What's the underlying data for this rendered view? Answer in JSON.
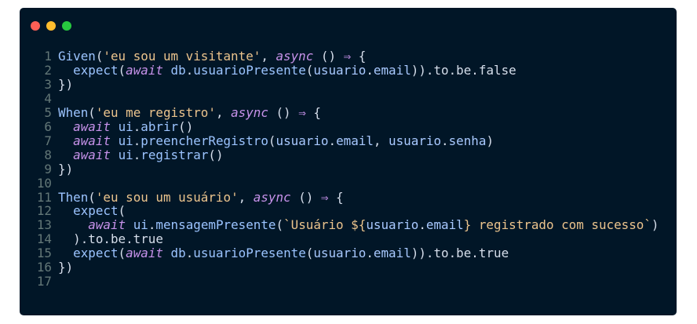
{
  "window": {
    "controls": [
      {
        "name": "close",
        "color": "#ff5f56"
      },
      {
        "name": "minimize",
        "color": "#ffbd2e"
      },
      {
        "name": "maximize",
        "color": "#27c93f"
      }
    ]
  },
  "code": {
    "lines": [
      [
        [
          "fn",
          "Given"
        ],
        [
          "p",
          "("
        ],
        [
          "str",
          "'eu sou um visitante'"
        ],
        [
          "p",
          ", "
        ],
        [
          "kw",
          "async"
        ],
        [
          "p",
          " () "
        ],
        [
          "op",
          "⇒"
        ],
        [
          "p",
          " {"
        ]
      ],
      [
        [
          "p",
          "  "
        ],
        [
          "fn",
          "expect"
        ],
        [
          "p",
          "("
        ],
        [
          "kw",
          "await"
        ],
        [
          "p",
          " "
        ],
        [
          "fn",
          "db"
        ],
        [
          "p",
          "."
        ],
        [
          "fn",
          "usuarioPresente"
        ],
        [
          "p",
          "("
        ],
        [
          "var",
          "usuario"
        ],
        [
          "p",
          "."
        ],
        [
          "var",
          "email"
        ],
        [
          "p",
          "))"
        ],
        [
          "p",
          ".to.be.false"
        ]
      ],
      [
        [
          "p",
          "})"
        ]
      ],
      [],
      [
        [
          "fn",
          "When"
        ],
        [
          "p",
          "("
        ],
        [
          "str",
          "'eu me registro'"
        ],
        [
          "p",
          ", "
        ],
        [
          "kw",
          "async"
        ],
        [
          "p",
          " () "
        ],
        [
          "op",
          "⇒"
        ],
        [
          "p",
          " {"
        ]
      ],
      [
        [
          "p",
          "  "
        ],
        [
          "kw",
          "await"
        ],
        [
          "p",
          " "
        ],
        [
          "fn",
          "ui"
        ],
        [
          "p",
          "."
        ],
        [
          "fn",
          "abrir"
        ],
        [
          "p",
          "()"
        ]
      ],
      [
        [
          "p",
          "  "
        ],
        [
          "kw",
          "await"
        ],
        [
          "p",
          " "
        ],
        [
          "fn",
          "ui"
        ],
        [
          "p",
          "."
        ],
        [
          "fn",
          "preencherRegistro"
        ],
        [
          "p",
          "("
        ],
        [
          "var",
          "usuario"
        ],
        [
          "p",
          "."
        ],
        [
          "var",
          "email"
        ],
        [
          "p",
          ", "
        ],
        [
          "var",
          "usuario"
        ],
        [
          "p",
          "."
        ],
        [
          "var",
          "senha"
        ],
        [
          "p",
          ")"
        ]
      ],
      [
        [
          "p",
          "  "
        ],
        [
          "kw",
          "await"
        ],
        [
          "p",
          " "
        ],
        [
          "fn",
          "ui"
        ],
        [
          "p",
          "."
        ],
        [
          "fn",
          "registrar"
        ],
        [
          "p",
          "()"
        ]
      ],
      [
        [
          "p",
          "})"
        ]
      ],
      [],
      [
        [
          "fn",
          "Then"
        ],
        [
          "p",
          "("
        ],
        [
          "str",
          "'eu sou um usuário'"
        ],
        [
          "p",
          ", "
        ],
        [
          "kw",
          "async"
        ],
        [
          "p",
          " () "
        ],
        [
          "op",
          "⇒"
        ],
        [
          "p",
          " {"
        ]
      ],
      [
        [
          "p",
          "  "
        ],
        [
          "fn",
          "expect"
        ],
        [
          "p",
          "("
        ]
      ],
      [
        [
          "p",
          "    "
        ],
        [
          "kw",
          "await"
        ],
        [
          "p",
          " "
        ],
        [
          "fn",
          "ui"
        ],
        [
          "p",
          "."
        ],
        [
          "fn",
          "mensagemPresente"
        ],
        [
          "p",
          "("
        ],
        [
          "str",
          "`Usuário ${"
        ],
        [
          "var",
          "usuario"
        ],
        [
          "p",
          "."
        ],
        [
          "var",
          "email"
        ],
        [
          "str",
          "} registrado com sucesso`"
        ],
        [
          "p",
          ")"
        ]
      ],
      [
        [
          "p",
          "  ).to.be.true"
        ]
      ],
      [
        [
          "p",
          "  "
        ],
        [
          "fn",
          "expect"
        ],
        [
          "p",
          "("
        ],
        [
          "kw",
          "await"
        ],
        [
          "p",
          " "
        ],
        [
          "fn",
          "db"
        ],
        [
          "p",
          "."
        ],
        [
          "fn",
          "usuarioPresente"
        ],
        [
          "p",
          "("
        ],
        [
          "var",
          "usuario"
        ],
        [
          "p",
          "."
        ],
        [
          "var",
          "email"
        ],
        [
          "p",
          "))"
        ],
        [
          "p",
          ".to.be.true"
        ]
      ],
      [
        [
          "p",
          "})"
        ]
      ],
      []
    ]
  }
}
